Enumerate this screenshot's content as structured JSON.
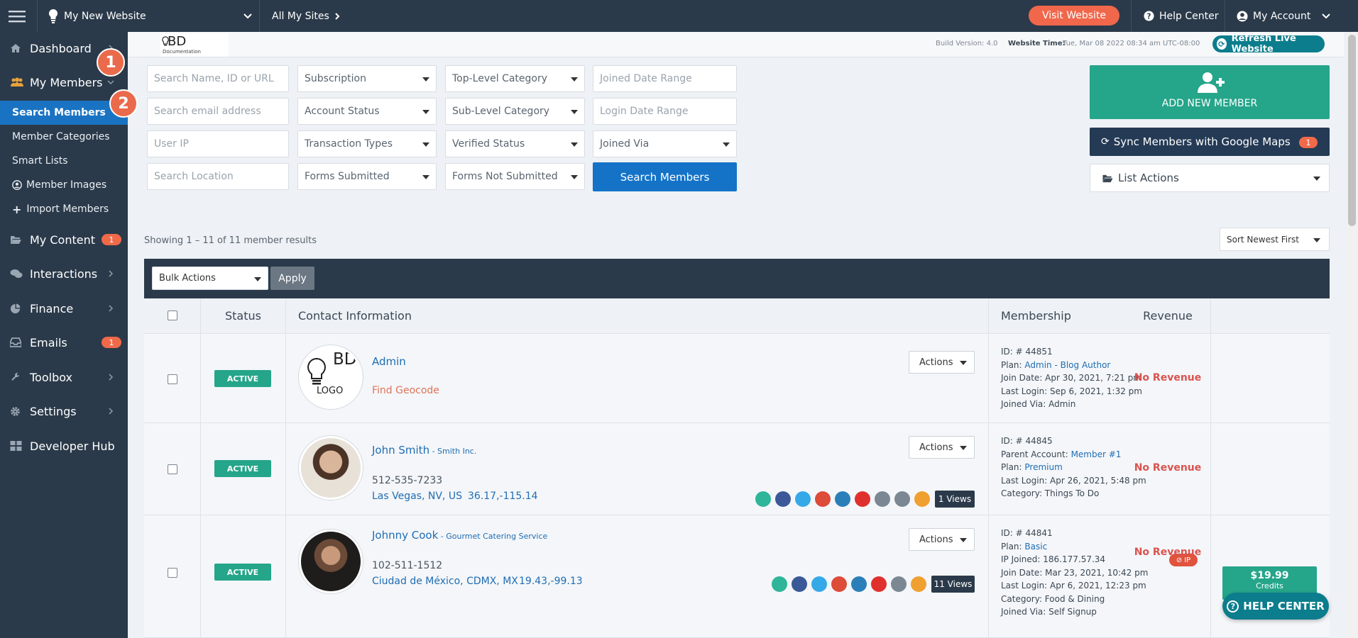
{
  "topbar": {
    "site_name": "My New Website",
    "all_sites": "All My Sites",
    "visit_website": "Visit Website",
    "help_center": "Help Center",
    "my_account": "My Account"
  },
  "sidebar": {
    "dashboard": "Dashboard",
    "my_members": "My Members",
    "search_members": "Search Members",
    "member_categories": "Member Categories",
    "smart_lists": "Smart Lists",
    "member_images": "Member Images",
    "import_members": "Import Members",
    "my_content": "My Content",
    "my_content_badge": "1",
    "interactions": "Interactions",
    "finance": "Finance",
    "emails": "Emails",
    "emails_badge": "1",
    "toolbox": "Toolbox",
    "settings": "Settings",
    "developer_hub": "Developer Hub",
    "step1": "1",
    "step2": "2"
  },
  "infobar": {
    "logo_text": "BD",
    "logo_sub": "Documentation",
    "build_version": "Build Version: 4.0",
    "website_time_label": "Website Time:",
    "website_time": "Tue, Mar 08 2022 08:34 am UTC-08:00",
    "refresh": "Refresh Live Website"
  },
  "filters": {
    "search_name": "Search Name, ID or URL",
    "search_email": "Search email address",
    "user_ip": "User IP",
    "search_location": "Search Location",
    "subscription": "Subscription",
    "account_status": "Account Status",
    "transaction_types": "Transaction Types",
    "forms_submitted": "Forms Submitted",
    "top_level_category": "Top-Level Category",
    "sub_level_category": "Sub-Level Category",
    "verified_status": "Verified Status",
    "forms_not_submitted": "Forms Not Submitted",
    "joined_date_range": "Joined Date Range",
    "login_date_range": "Login Date Range",
    "joined_via": "Joined Via",
    "search_button": "Search Members"
  },
  "right_panel": {
    "add_member": "ADD NEW MEMBER",
    "sync": "Sync Members with Google Maps",
    "sync_badge": "1",
    "list_actions": "List Actions"
  },
  "results": {
    "showing": "Showing 1 – 11 of 11 member results",
    "sort": "Sort Newest First",
    "bulk_actions": "Bulk Actions",
    "apply": "Apply",
    "headers": {
      "status": "Status",
      "contact": "Contact Information",
      "membership": "Membership",
      "revenue": "Revenue"
    }
  },
  "rows": [
    {
      "status": "ACTIVE",
      "name": "Admin",
      "extra_link": "Find Geocode",
      "actions": "Actions",
      "logo_top": "BD",
      "logo_bottom": "LOGO",
      "id": "ID: # 44851",
      "plan_label": "Plan:",
      "plan": "Admin - Blog Author",
      "join_date": "Join Date: Apr 30, 2021, 7:21 pm",
      "last_login": "Last Login: Sep 6, 2021, 1:32 pm",
      "joined_via": "Joined Via: Admin",
      "revenue": "No Revenue"
    },
    {
      "status": "ACTIVE",
      "name": "John Smith",
      "company": " - Smith Inc.",
      "phone": "512-535-7233",
      "location": "Las Vegas, NV, US",
      "coords": "36.17,-115.14",
      "views": "1 Views",
      "actions": "Actions",
      "id": "ID: # 44845",
      "parent_label": "Parent Account:",
      "parent": "Member #1",
      "plan_label": "Plan:",
      "plan": "Premium",
      "last_login": "Last Login: Apr 26, 2021, 5:48 pm",
      "category": "Category: Things To Do",
      "revenue": "No Revenue"
    },
    {
      "status": "ACTIVE",
      "name": "Johnny Cook",
      "company": " - Gourmet Catering Service",
      "phone": "102-511-1512",
      "location": "Ciudad de México, CDMX, MX",
      "coords": "19.43,-99.13",
      "views": "11 Views",
      "actions": "Actions",
      "id": "ID: # 44841",
      "plan_label": "Plan:",
      "plan": "Basic",
      "ip_joined": "IP Joined: 186.177.57.34",
      "ip_badge": "IP",
      "join_date": "Join Date: Mar 23, 2021, 10:42 pm",
      "last_login": "Last Login: Apr 6, 2021, 12:23 pm",
      "category": "Category: Food & Dining",
      "joined_via": "Joined Via: Self Signup",
      "revenue": "No Revenue",
      "credits_amount": "$19.99",
      "credits_label": "Credits"
    }
  ],
  "help_button": "HELP CENTER"
}
